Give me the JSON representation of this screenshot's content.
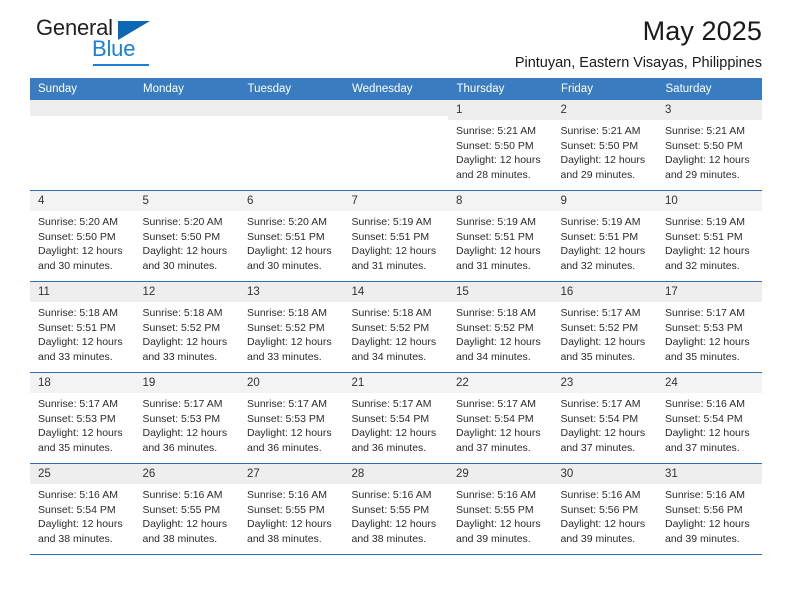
{
  "logo": {
    "word_general": "General",
    "word_blue": "Blue",
    "triangle_color": "#0c68b5",
    "blue_color": "#1b7fd4"
  },
  "header": {
    "title": "May 2025",
    "subtitle": "Pintuyan, Eastern Visayas, Philippines"
  },
  "theme": {
    "header_bg": "#3a7cc0",
    "header_text": "#ffffff",
    "row_divider": "#2f6fb0",
    "shaded_cell": "#f5f5f5"
  },
  "calendar": {
    "weekday_headers": [
      "Sunday",
      "Monday",
      "Tuesday",
      "Wednesday",
      "Thursday",
      "Friday",
      "Saturday"
    ],
    "weeks": [
      [
        {
          "day": "",
          "sunrise": "",
          "sunset": "",
          "daylight1": "",
          "daylight2": ""
        },
        {
          "day": "",
          "sunrise": "",
          "sunset": "",
          "daylight1": "",
          "daylight2": ""
        },
        {
          "day": "",
          "sunrise": "",
          "sunset": "",
          "daylight1": "",
          "daylight2": ""
        },
        {
          "day": "",
          "sunrise": "",
          "sunset": "",
          "daylight1": "",
          "daylight2": ""
        },
        {
          "day": "1",
          "sunrise": "Sunrise: 5:21 AM",
          "sunset": "Sunset: 5:50 PM",
          "daylight1": "Daylight: 12 hours",
          "daylight2": "and 28 minutes."
        },
        {
          "day": "2",
          "sunrise": "Sunrise: 5:21 AM",
          "sunset": "Sunset: 5:50 PM",
          "daylight1": "Daylight: 12 hours",
          "daylight2": "and 29 minutes."
        },
        {
          "day": "3",
          "sunrise": "Sunrise: 5:21 AM",
          "sunset": "Sunset: 5:50 PM",
          "daylight1": "Daylight: 12 hours",
          "daylight2": "and 29 minutes."
        }
      ],
      [
        {
          "day": "4",
          "sunrise": "Sunrise: 5:20 AM",
          "sunset": "Sunset: 5:50 PM",
          "daylight1": "Daylight: 12 hours",
          "daylight2": "and 30 minutes."
        },
        {
          "day": "5",
          "sunrise": "Sunrise: 5:20 AM",
          "sunset": "Sunset: 5:50 PM",
          "daylight1": "Daylight: 12 hours",
          "daylight2": "and 30 minutes."
        },
        {
          "day": "6",
          "sunrise": "Sunrise: 5:20 AM",
          "sunset": "Sunset: 5:51 PM",
          "daylight1": "Daylight: 12 hours",
          "daylight2": "and 30 minutes."
        },
        {
          "day": "7",
          "sunrise": "Sunrise: 5:19 AM",
          "sunset": "Sunset: 5:51 PM",
          "daylight1": "Daylight: 12 hours",
          "daylight2": "and 31 minutes."
        },
        {
          "day": "8",
          "sunrise": "Sunrise: 5:19 AM",
          "sunset": "Sunset: 5:51 PM",
          "daylight1": "Daylight: 12 hours",
          "daylight2": "and 31 minutes."
        },
        {
          "day": "9",
          "sunrise": "Sunrise: 5:19 AM",
          "sunset": "Sunset: 5:51 PM",
          "daylight1": "Daylight: 12 hours",
          "daylight2": "and 32 minutes."
        },
        {
          "day": "10",
          "sunrise": "Sunrise: 5:19 AM",
          "sunset": "Sunset: 5:51 PM",
          "daylight1": "Daylight: 12 hours",
          "daylight2": "and 32 minutes."
        }
      ],
      [
        {
          "day": "11",
          "sunrise": "Sunrise: 5:18 AM",
          "sunset": "Sunset: 5:51 PM",
          "daylight1": "Daylight: 12 hours",
          "daylight2": "and 33 minutes."
        },
        {
          "day": "12",
          "sunrise": "Sunrise: 5:18 AM",
          "sunset": "Sunset: 5:52 PM",
          "daylight1": "Daylight: 12 hours",
          "daylight2": "and 33 minutes."
        },
        {
          "day": "13",
          "sunrise": "Sunrise: 5:18 AM",
          "sunset": "Sunset: 5:52 PM",
          "daylight1": "Daylight: 12 hours",
          "daylight2": "and 33 minutes."
        },
        {
          "day": "14",
          "sunrise": "Sunrise: 5:18 AM",
          "sunset": "Sunset: 5:52 PM",
          "daylight1": "Daylight: 12 hours",
          "daylight2": "and 34 minutes."
        },
        {
          "day": "15",
          "sunrise": "Sunrise: 5:18 AM",
          "sunset": "Sunset: 5:52 PM",
          "daylight1": "Daylight: 12 hours",
          "daylight2": "and 34 minutes."
        },
        {
          "day": "16",
          "sunrise": "Sunrise: 5:17 AM",
          "sunset": "Sunset: 5:52 PM",
          "daylight1": "Daylight: 12 hours",
          "daylight2": "and 35 minutes."
        },
        {
          "day": "17",
          "sunrise": "Sunrise: 5:17 AM",
          "sunset": "Sunset: 5:53 PM",
          "daylight1": "Daylight: 12 hours",
          "daylight2": "and 35 minutes."
        }
      ],
      [
        {
          "day": "18",
          "sunrise": "Sunrise: 5:17 AM",
          "sunset": "Sunset: 5:53 PM",
          "daylight1": "Daylight: 12 hours",
          "daylight2": "and 35 minutes."
        },
        {
          "day": "19",
          "sunrise": "Sunrise: 5:17 AM",
          "sunset": "Sunset: 5:53 PM",
          "daylight1": "Daylight: 12 hours",
          "daylight2": "and 36 minutes."
        },
        {
          "day": "20",
          "sunrise": "Sunrise: 5:17 AM",
          "sunset": "Sunset: 5:53 PM",
          "daylight1": "Daylight: 12 hours",
          "daylight2": "and 36 minutes."
        },
        {
          "day": "21",
          "sunrise": "Sunrise: 5:17 AM",
          "sunset": "Sunset: 5:54 PM",
          "daylight1": "Daylight: 12 hours",
          "daylight2": "and 36 minutes."
        },
        {
          "day": "22",
          "sunrise": "Sunrise: 5:17 AM",
          "sunset": "Sunset: 5:54 PM",
          "daylight1": "Daylight: 12 hours",
          "daylight2": "and 37 minutes."
        },
        {
          "day": "23",
          "sunrise": "Sunrise: 5:17 AM",
          "sunset": "Sunset: 5:54 PM",
          "daylight1": "Daylight: 12 hours",
          "daylight2": "and 37 minutes."
        },
        {
          "day": "24",
          "sunrise": "Sunrise: 5:16 AM",
          "sunset": "Sunset: 5:54 PM",
          "daylight1": "Daylight: 12 hours",
          "daylight2": "and 37 minutes."
        }
      ],
      [
        {
          "day": "25",
          "sunrise": "Sunrise: 5:16 AM",
          "sunset": "Sunset: 5:54 PM",
          "daylight1": "Daylight: 12 hours",
          "daylight2": "and 38 minutes."
        },
        {
          "day": "26",
          "sunrise": "Sunrise: 5:16 AM",
          "sunset": "Sunset: 5:55 PM",
          "daylight1": "Daylight: 12 hours",
          "daylight2": "and 38 minutes."
        },
        {
          "day": "27",
          "sunrise": "Sunrise: 5:16 AM",
          "sunset": "Sunset: 5:55 PM",
          "daylight1": "Daylight: 12 hours",
          "daylight2": "and 38 minutes."
        },
        {
          "day": "28",
          "sunrise": "Sunrise: 5:16 AM",
          "sunset": "Sunset: 5:55 PM",
          "daylight1": "Daylight: 12 hours",
          "daylight2": "and 38 minutes."
        },
        {
          "day": "29",
          "sunrise": "Sunrise: 5:16 AM",
          "sunset": "Sunset: 5:55 PM",
          "daylight1": "Daylight: 12 hours",
          "daylight2": "and 39 minutes."
        },
        {
          "day": "30",
          "sunrise": "Sunrise: 5:16 AM",
          "sunset": "Sunset: 5:56 PM",
          "daylight1": "Daylight: 12 hours",
          "daylight2": "and 39 minutes."
        },
        {
          "day": "31",
          "sunrise": "Sunrise: 5:16 AM",
          "sunset": "Sunset: 5:56 PM",
          "daylight1": "Daylight: 12 hours",
          "daylight2": "and 39 minutes."
        }
      ]
    ]
  }
}
